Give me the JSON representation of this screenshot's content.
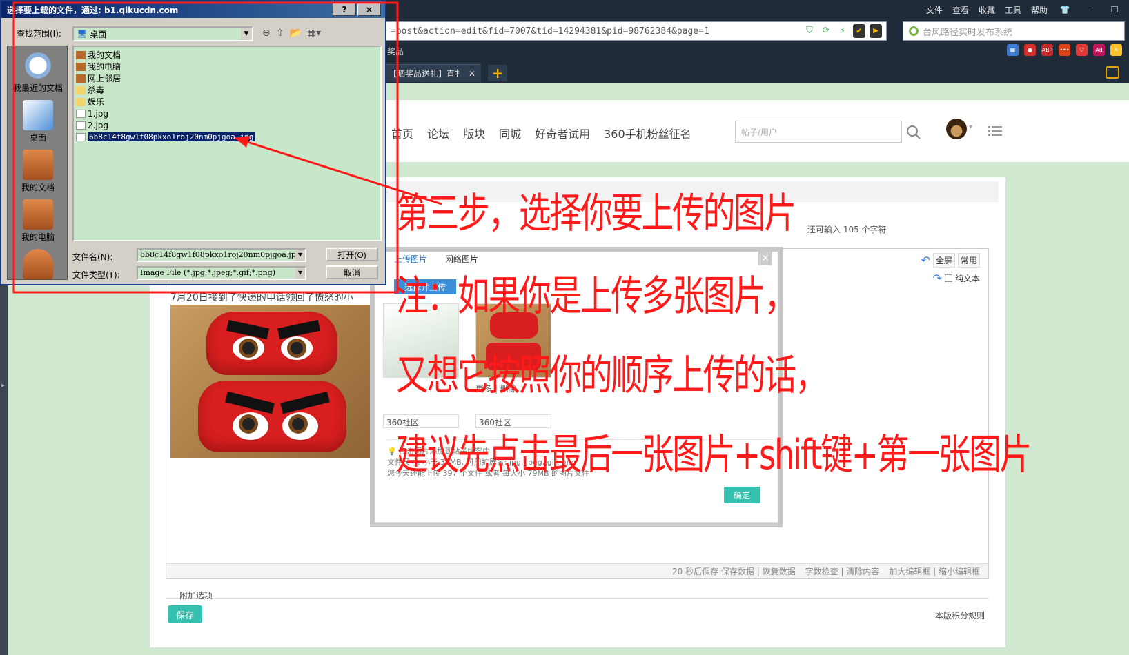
{
  "browser": {
    "menu": [
      "文件",
      "查看",
      "收藏",
      "工具",
      "帮助"
    ],
    "url": "=post&action=edit&fid=7007&tid=14294381&pid=98762384&page=1",
    "search_placeholder": "台风路径实时发布系统",
    "favbar_text": "奖品",
    "tab_title": "【晒奖品送礼】直扌",
    "new_tab": "+"
  },
  "site": {
    "nav": [
      "首页",
      "论坛",
      "版块",
      "同城",
      "好奇者试用",
      "360手机粉丝征名"
    ],
    "search_placeholder": "帖子/用户",
    "char_hint": "还可输入 105 个字符"
  },
  "editor": {
    "tools": {
      "fullscreen": "全屏",
      "common": "常用",
      "plain_text": "纯文本"
    },
    "post_text": "7月20日接到了快递的电话领回了愤怒的小",
    "status": [
      "20 秒后保存 保存数据 | 恢复数据",
      "字数检查 | 清除内容",
      "加大编辑框 | 缩小编辑框"
    ],
    "extra_options": "附加选项",
    "save": "保存",
    "credit_rule": "本版积分规则"
  },
  "upload_dialog": {
    "tabs": [
      "上传图片",
      "网络图片"
    ],
    "select_button": "选择并上传",
    "thumbs": [
      {
        "caption": "",
        "tag": "360社区"
      },
      {
        "caption": "更多 | 删除",
        "tag": "360社区"
      }
    ],
    "info": [
      "点击图片添加到帖子内容中",
      "文件尺寸: 小于 36MB, 可用扩展名: jpg, jpeg, gif, png",
      "您今天还能上传 397 个文件 或者 每大小 79MB 的图片文件"
    ],
    "ok": "确定"
  },
  "file_dialog": {
    "title": "选择要上载的文件，通过: b1.qikucdn.com",
    "title_buttons": [
      "?",
      "×"
    ],
    "lookin_label": "查找范围(I):",
    "lookin_value": "桌面",
    "places": [
      "我最近的文档",
      "桌面",
      "我的文档",
      "我的电脑"
    ],
    "files": [
      "我的文档",
      "我的电脑",
      "网上邻居",
      "杀毒",
      "娱乐",
      "1.jpg",
      "2.jpg",
      "6b8c14f8gw1f08pkxo1roj20nm0pjgoa.jpg"
    ],
    "filename_label": "文件名(N):",
    "filename_value": "6b8c14f8gw1f08pkxo1roj20nm0pjgoa.jpg",
    "filetype_label": "文件类型(T):",
    "filetype_value": "Image File (*.jpg;*.jpeg;*.gif;*.png)",
    "open": "打开(O)",
    "cancel": "取消"
  },
  "annotation": {
    "color": "#ff1a1a",
    "lines": [
      "第三步，选择你要上传的图片",
      "注：如果你是上传多张图片，",
      "又想它按照你的顺序上传的话，",
      "建议先点击最后一张图片+shift键+第一张图片"
    ]
  }
}
